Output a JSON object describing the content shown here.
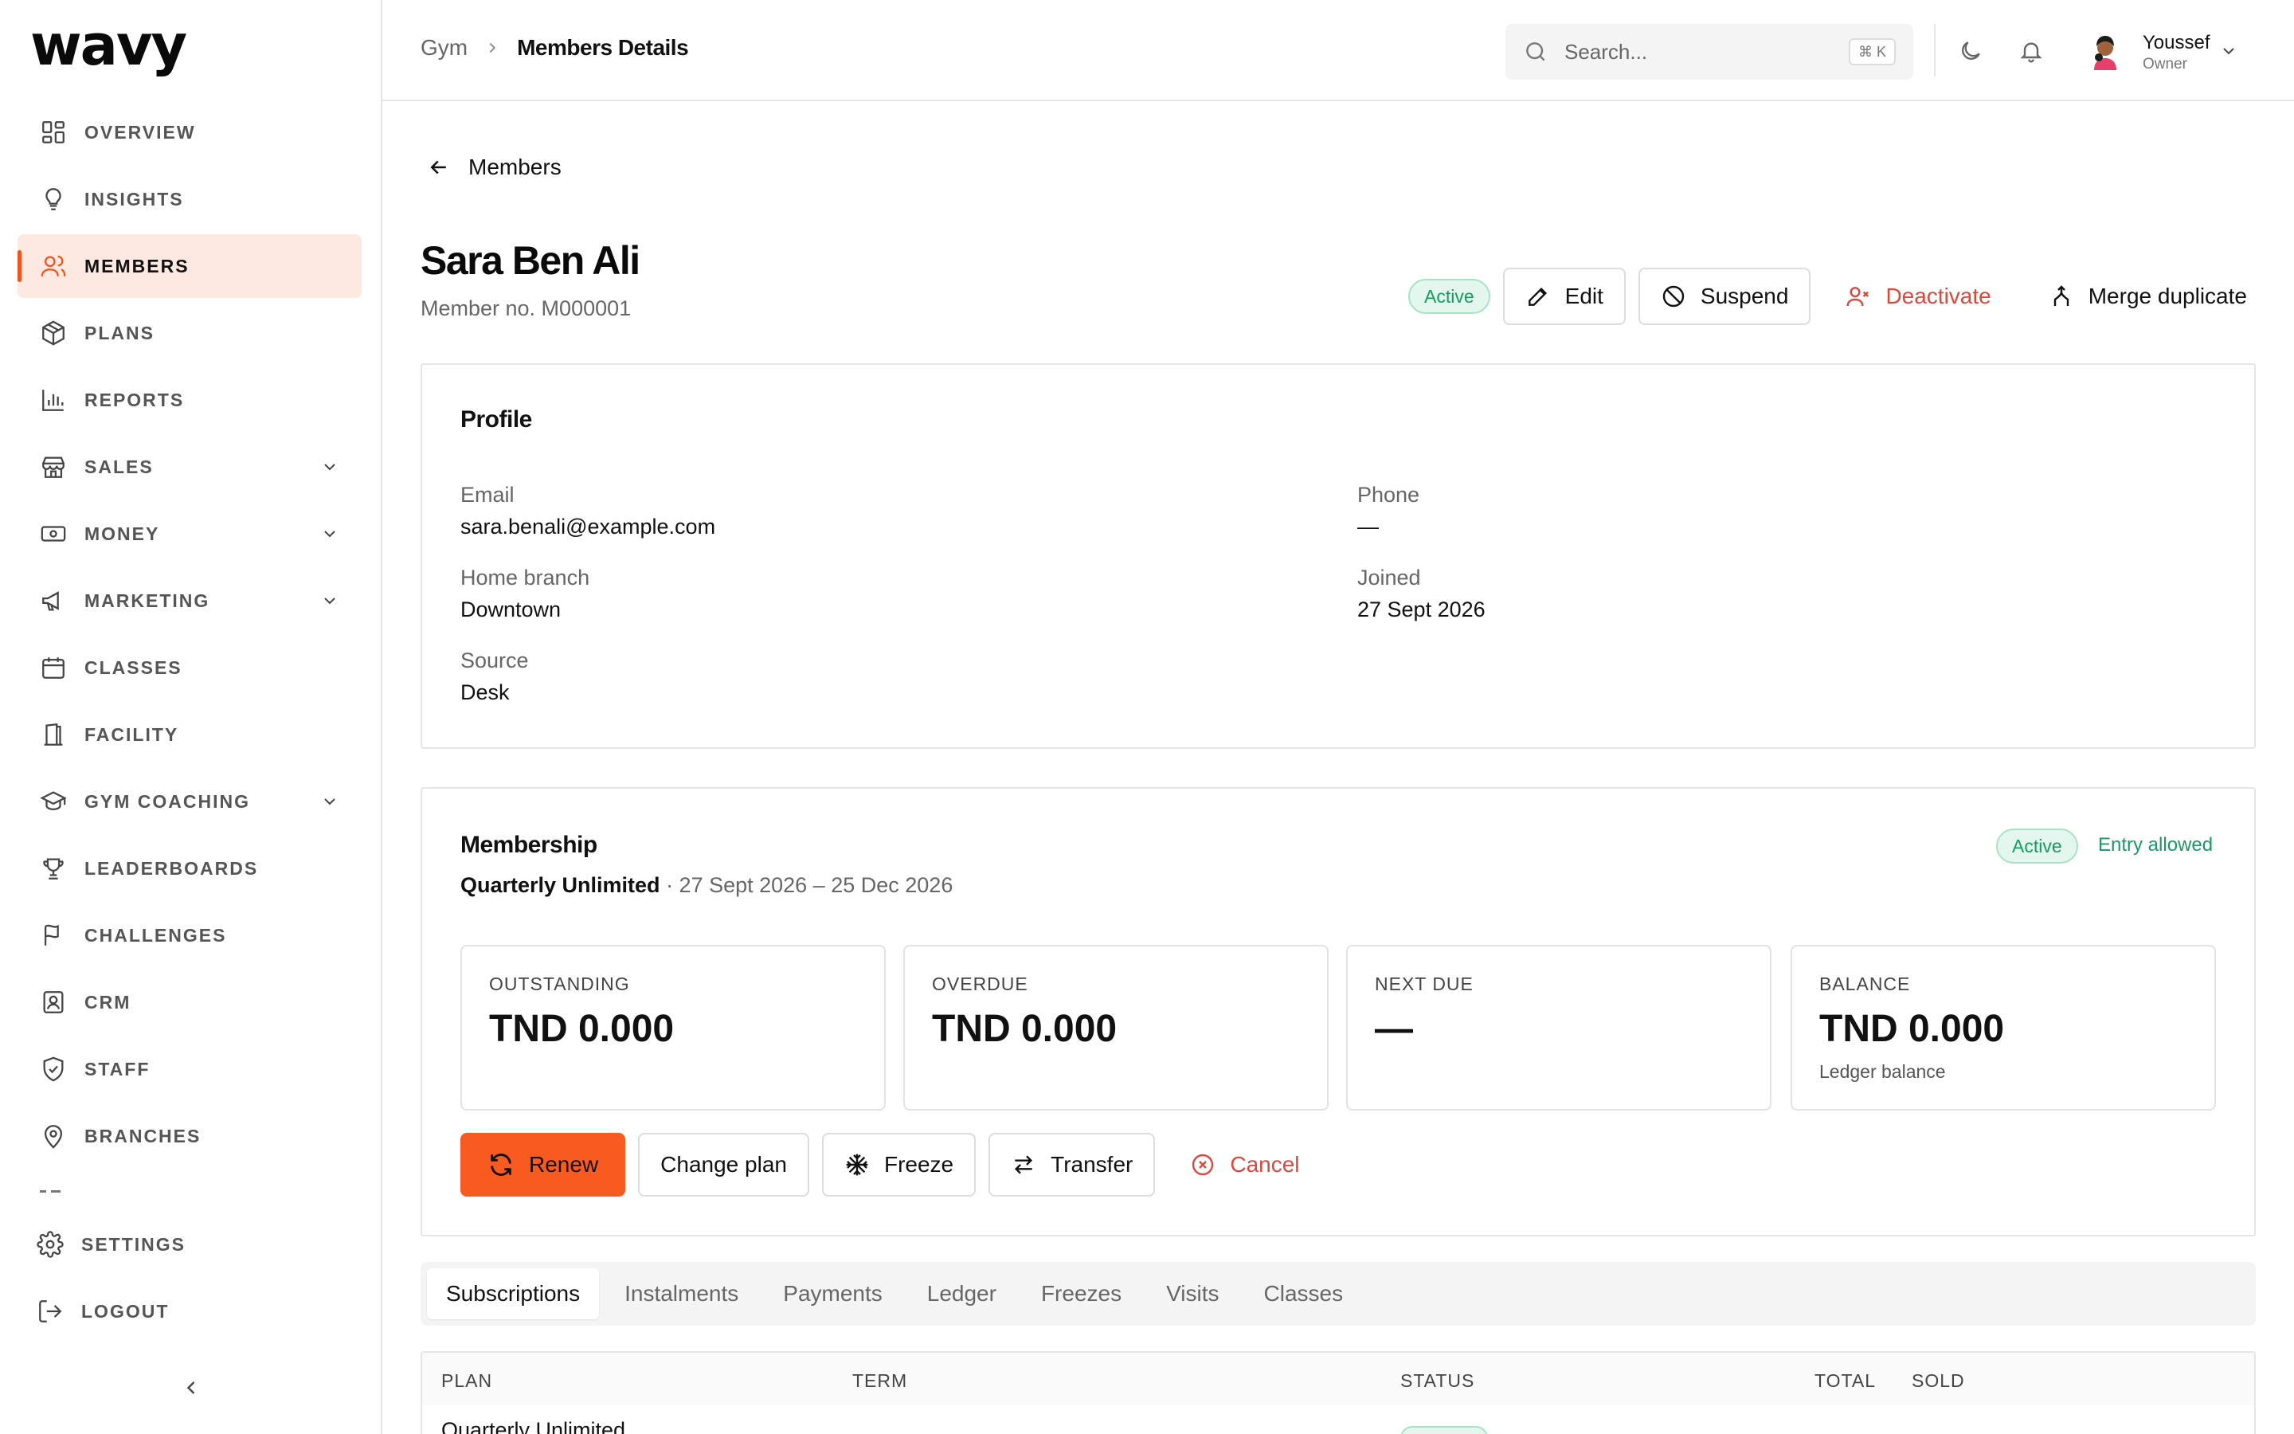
{
  "app": {
    "logo": "wavy"
  },
  "sidebar": {
    "items": [
      {
        "label": "OVERVIEW",
        "icon": "dashboard-icon"
      },
      {
        "label": "INSIGHTS",
        "icon": "lightbulb-icon"
      },
      {
        "label": "MEMBERS",
        "icon": "users-icon",
        "active": true
      },
      {
        "label": "PLANS",
        "icon": "package-icon"
      },
      {
        "label": "REPORTS",
        "icon": "bar-chart-icon"
      },
      {
        "label": "SALES",
        "icon": "store-icon",
        "expandable": true
      },
      {
        "label": "MONEY",
        "icon": "banknote-icon",
        "expandable": true
      },
      {
        "label": "MARKETING",
        "icon": "megaphone-icon",
        "expandable": true
      },
      {
        "label": "CLASSES",
        "icon": "calendar-icon"
      },
      {
        "label": "FACILITY",
        "icon": "door-icon"
      },
      {
        "label": "GYM COACHING",
        "icon": "graduation-cap-icon",
        "expandable": true
      },
      {
        "label": "LEADERBOARDS",
        "icon": "trophy-icon"
      },
      {
        "label": "CHALLENGES",
        "icon": "flag-icon"
      },
      {
        "label": "CRM",
        "icon": "contact-icon"
      },
      {
        "label": "STAFF",
        "icon": "shield-icon"
      },
      {
        "label": "BRANCHES",
        "icon": "map-pin-icon"
      }
    ],
    "bottom": [
      {
        "label": "SETTINGS",
        "icon": "gear-icon"
      },
      {
        "label": "LOGOUT",
        "icon": "logout-icon"
      }
    ]
  },
  "topbar": {
    "breadcrumb_root": "Gym",
    "breadcrumb_current": "Members Details",
    "search_placeholder": "Search...",
    "search_shortcut": "⌘ K",
    "user_name": "Youssef",
    "user_role": "Owner"
  },
  "member": {
    "back_label": "Members",
    "name": "Sara Ben Ali",
    "number": "Member no. M000001",
    "status": "Active",
    "actions": {
      "edit": "Edit",
      "suspend": "Suspend",
      "deactivate": "Deactivate",
      "merge": "Merge duplicate"
    }
  },
  "profile": {
    "title": "Profile",
    "email_label": "Email",
    "email": "sara.benali@example.com",
    "phone_label": "Phone",
    "phone": "—",
    "branch_label": "Home branch",
    "branch": "Downtown",
    "joined_label": "Joined",
    "joined": "27 Sept 2026",
    "source_label": "Source",
    "source": "Desk"
  },
  "membership": {
    "title": "Membership",
    "plan": "Quarterly Unlimited",
    "period": " · 27 Sept 2026 – 25 Dec 2026",
    "status": "Active",
    "entry": "Entry allowed",
    "stats": [
      {
        "label": "OUTSTANDING",
        "value": "TND 0.000",
        "note": ""
      },
      {
        "label": "OVERDUE",
        "value": "TND 0.000",
        "note": ""
      },
      {
        "label": "NEXT DUE",
        "value": "—",
        "note": ""
      },
      {
        "label": "BALANCE",
        "value": "TND 0.000",
        "note": "Ledger balance"
      }
    ],
    "actions": {
      "renew": "Renew",
      "change_plan": "Change plan",
      "freeze": "Freeze",
      "transfer": "Transfer",
      "cancel": "Cancel"
    }
  },
  "tabs": [
    "Subscriptions",
    "Instalments",
    "Payments",
    "Ledger",
    "Freezes",
    "Visits",
    "Classes"
  ],
  "table": {
    "columns": [
      "PLAN",
      "TERM",
      "STATUS",
      "TOTAL",
      "SOLD"
    ],
    "rows": [
      {
        "plan": "Quarterly Unlimited"
      }
    ]
  },
  "colors": {
    "accent": "#f95a1f",
    "active_nav_bg": "#fde9e2",
    "success": "#1a9a63",
    "danger": "#d84a3e"
  }
}
